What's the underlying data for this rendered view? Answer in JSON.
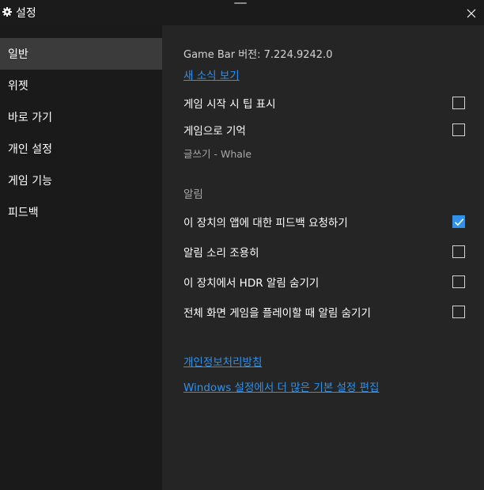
{
  "window": {
    "title": "설정"
  },
  "sidebar": {
    "items": [
      {
        "label": "일반"
      },
      {
        "label": "위젯"
      },
      {
        "label": "바로 가기"
      },
      {
        "label": "개인 설정"
      },
      {
        "label": "게임 기능"
      },
      {
        "label": "피드백"
      }
    ],
    "selected": "일반"
  },
  "general": {
    "version": "Game Bar 버전: 7.224.9242.0",
    "whats_new_link": "새 소식 보기",
    "show_tips_label": "게임 시작 시 팁 표시",
    "show_tips_checked": false,
    "remember_game_label": "게임으로 기억",
    "remember_game_checked": false,
    "remember_game_sub": "글쓰기 - Whale"
  },
  "notifications": {
    "section_title": "알림",
    "items": [
      {
        "label": "이 장치의 앱에 대한 피드백 요청하기",
        "checked": true
      },
      {
        "label": "알림 소리 조용히",
        "checked": false
      },
      {
        "label": "이 장치에서 HDR 알림 숨기기",
        "checked": false
      },
      {
        "label": "전체 화면 게임을 플레이할 때 알림 숨기기",
        "checked": false
      }
    ]
  },
  "links": {
    "privacy": "개인정보처리방침",
    "windows_settings": "Windows 설정에서 더 많은 기본 설정 편집"
  },
  "colors": {
    "accent": "#2f91ea",
    "sidebar_bg": "#1a1a1a",
    "content_bg": "#252525",
    "selected_bg": "#3b3b3b"
  }
}
